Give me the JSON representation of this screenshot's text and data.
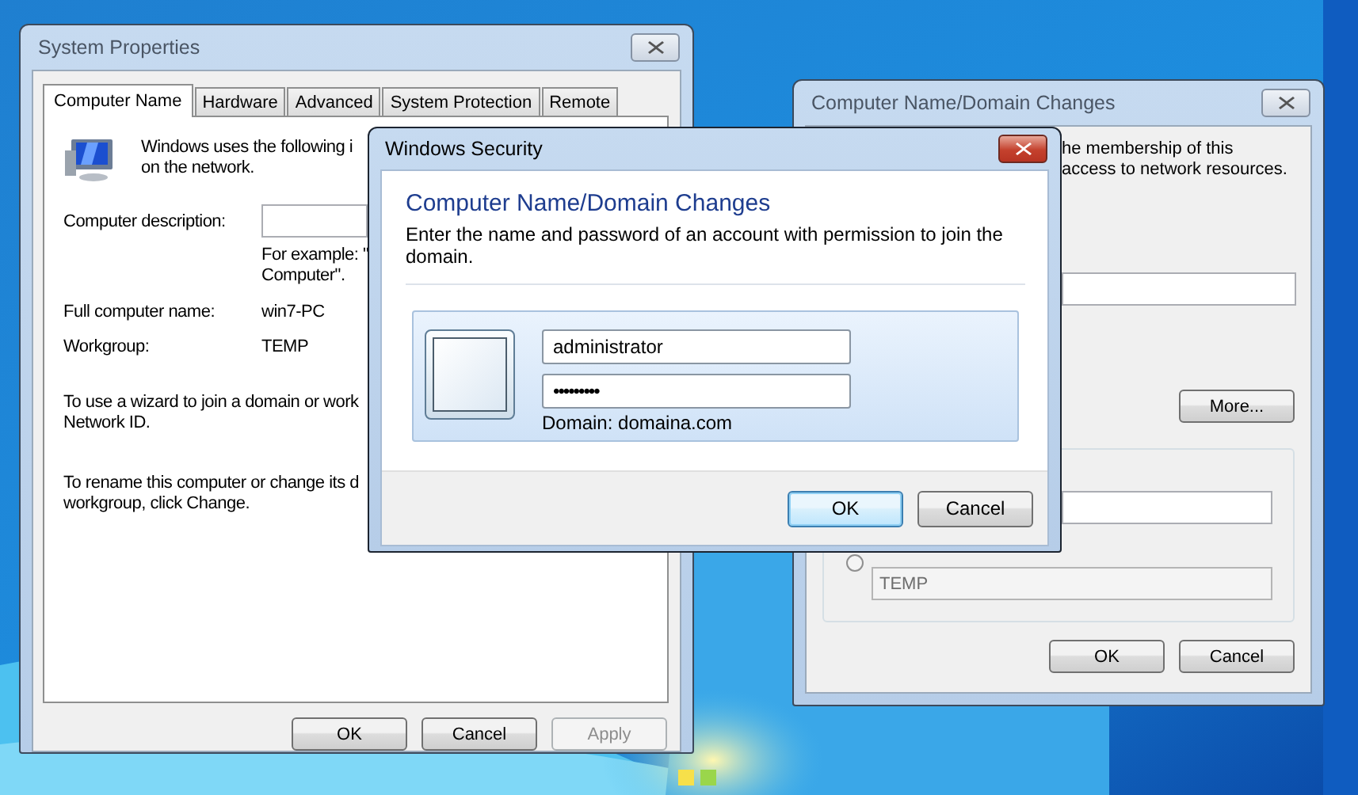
{
  "system_properties": {
    "title": "System Properties",
    "tabs": [
      {
        "label": "Computer Name",
        "selected": true
      },
      {
        "label": "Hardware",
        "selected": false
      },
      {
        "label": "Advanced",
        "selected": false
      },
      {
        "label": "System Protection",
        "selected": false
      },
      {
        "label": "Remote",
        "selected": false
      }
    ],
    "intro_lines": [
      "Windows uses the following i",
      "on the network."
    ],
    "description_label": "Computer description:",
    "example_lines": [
      "For example: \"",
      "Computer\"."
    ],
    "full_name_label": "Full computer name:",
    "full_name": "win7-PC",
    "workgroup_label": "Workgroup:",
    "workgroup": "TEMP",
    "wizard_lines": [
      "To use a wizard to join a domain or work",
      "Network ID."
    ],
    "rename_lines": [
      "To rename this computer or change its d",
      "workgroup, click Change."
    ],
    "buttons": [
      {
        "label": "OK",
        "disabled": false
      },
      {
        "label": "Cancel",
        "disabled": false
      },
      {
        "label": "Apply",
        "disabled": true
      }
    ]
  },
  "domain_changes": {
    "title": "Computer Name/Domain Changes",
    "intro_lines": [
      "he membership of this",
      "access to network resources."
    ],
    "more_button": "More...",
    "workgroup_radio": {
      "selected": false
    },
    "workgroup_value": "TEMP",
    "buttons": [
      {
        "label": "OK",
        "disabled": false
      },
      {
        "label": "Cancel",
        "disabled": false
      }
    ]
  },
  "windows_security": {
    "title": "Windows Security",
    "heading": "Computer Name/Domain Changes",
    "description": "Enter the name and password of an account with permission to join the domain.",
    "username": "administrator",
    "password": "•••••••••",
    "domain_text": "Domain: domaina.com",
    "buttons": [
      {
        "label": "OK",
        "focused": true
      },
      {
        "label": "Cancel",
        "focused": false
      }
    ]
  }
}
